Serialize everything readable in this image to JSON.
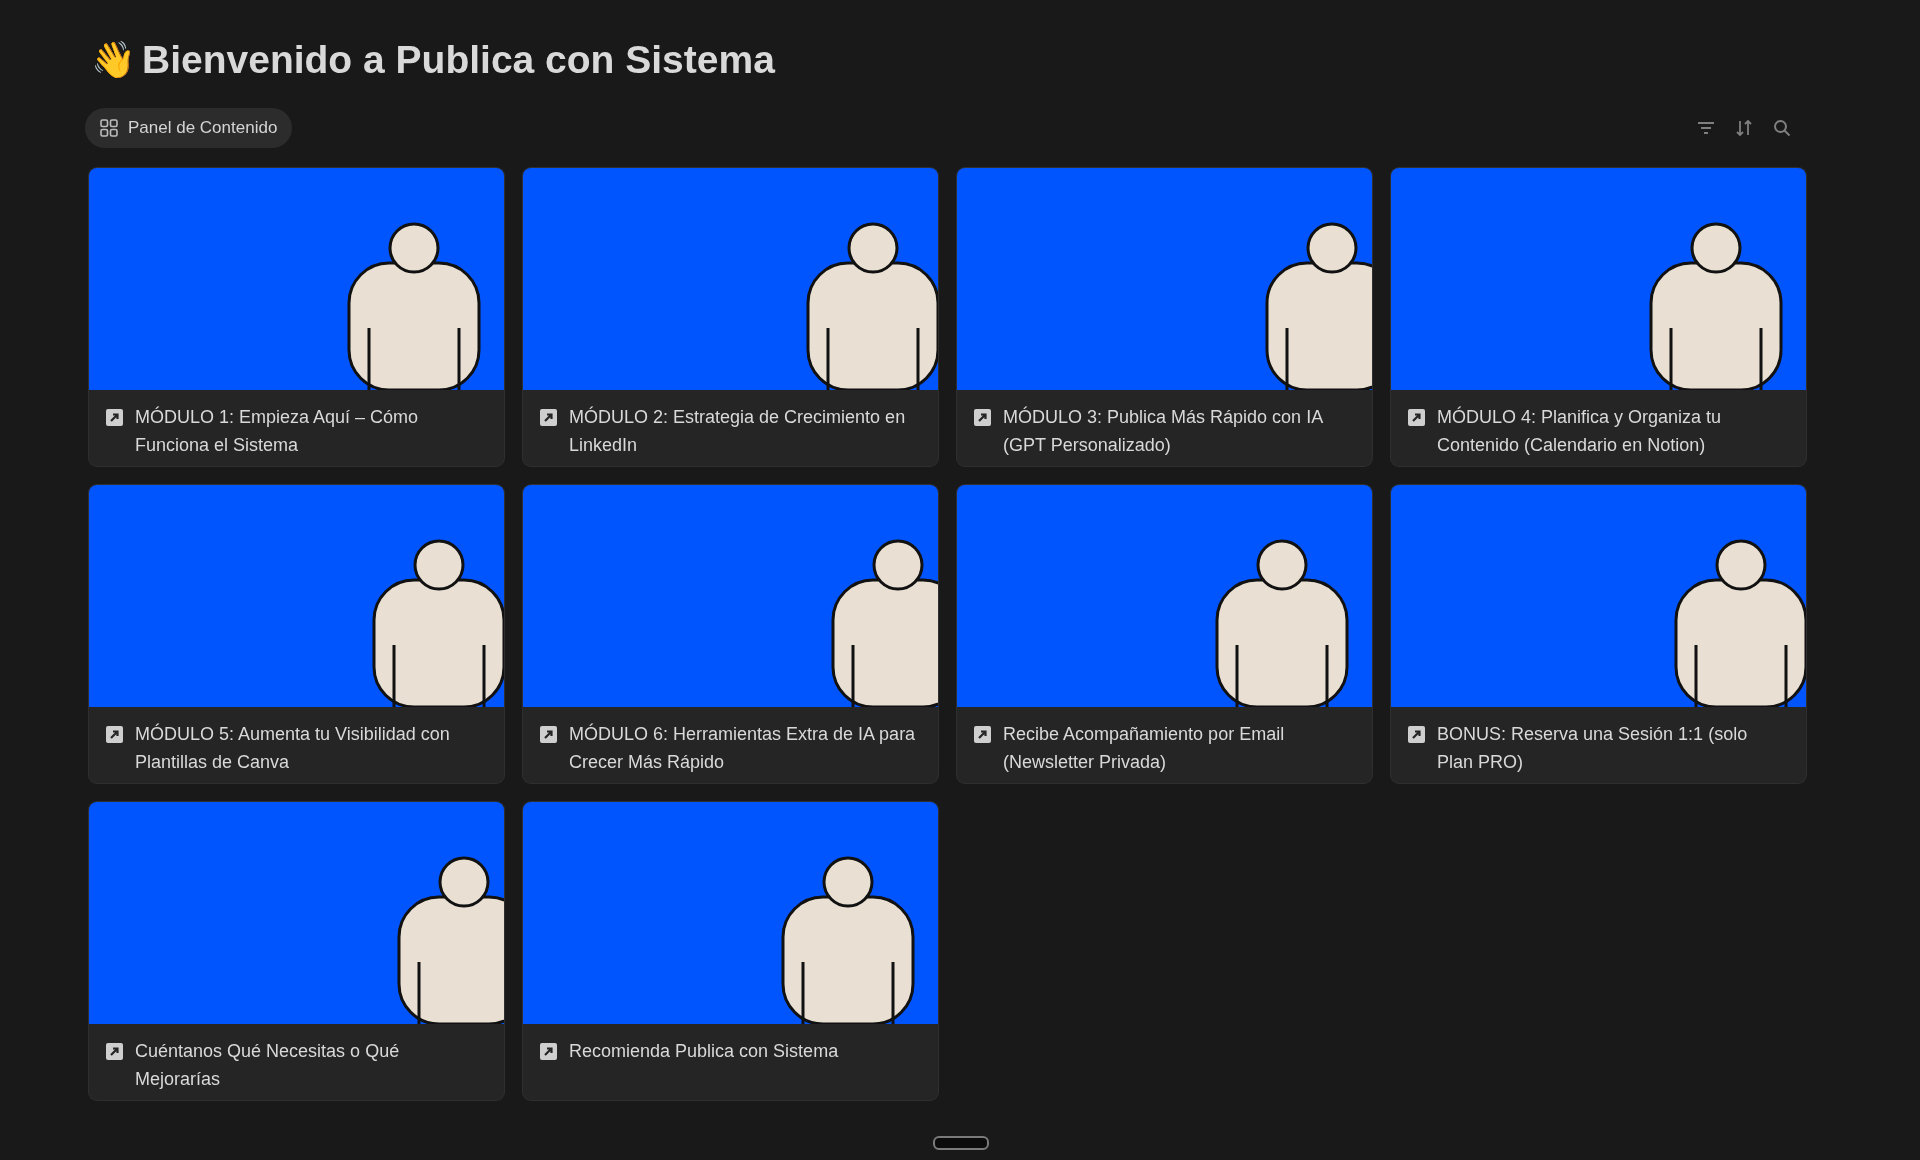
{
  "page": {
    "emoji": "👋",
    "title": "Bienvenido a Publica con Sistema"
  },
  "view_tab": {
    "label": "Panel de Contenido",
    "selected": true
  },
  "cards": [
    {
      "title": "MÓDULO 1: Empieza Aquí – Cómo Funciona el Sistema"
    },
    {
      "title": "MÓDULO 2: Estrategia de Crecimiento en LinkedIn"
    },
    {
      "title": "MÓDULO 3: Publica Más Rápido con IA (GPT Personalizado)"
    },
    {
      "title": "MÓDULO 4: Planifica y Organiza tu Contenido (Calendario en Notion)"
    },
    {
      "title": "MÓDULO 5: Aumenta tu Visibilidad con Plantillas de Canva"
    },
    {
      "title": "MÓDULO 6: Herramientas Extra de IA para Crecer Más Rápido"
    },
    {
      "title": "Recibe Acompañamiento por Email (Newsletter Privada)"
    },
    {
      "title": "BONUS: Reserva una Sesión 1:1 (solo Plan PRO)"
    },
    {
      "title": "Cuéntanos Qué Necesitas o Qué Mejorarías"
    },
    {
      "title": "Recomienda Publica con Sistema"
    }
  ]
}
